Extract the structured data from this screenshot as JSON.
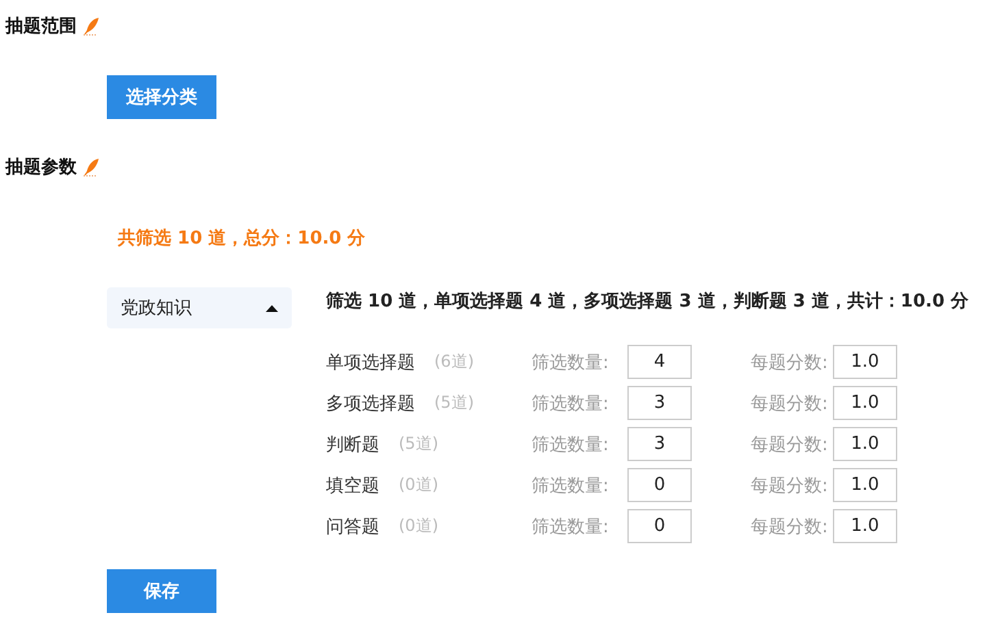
{
  "range_section": {
    "title": "抽题范围",
    "button": "选择分类"
  },
  "params_section": {
    "title": "抽题参数",
    "total": "共筛选 10 道，总分：10.0 分"
  },
  "category": {
    "name": "党政知识",
    "expanded": true,
    "summary": "筛选 10 道，单项选择题 4 道，多项选择题 3 道，判断题 3 道，共计：10.0 分"
  },
  "question_types": [
    {
      "name": "单项选择题",
      "available": "(6道)",
      "count_label": "筛选数量:",
      "count": "4",
      "score_label": "每题分数:",
      "score": "1.0"
    },
    {
      "name": "多项选择题",
      "available": "(5道)",
      "count_label": "筛选数量:",
      "count": "3",
      "score_label": "每题分数:",
      "score": "1.0"
    },
    {
      "name": "判断题",
      "available": "(5道)",
      "count_label": "筛选数量:",
      "count": "3",
      "score_label": "每题分数:",
      "score": "1.0"
    },
    {
      "name": "填空题",
      "available": "(0道)",
      "count_label": "筛选数量:",
      "count": "0",
      "score_label": "每题分数:",
      "score": "1.0"
    },
    {
      "name": "问答题",
      "available": "(0道)",
      "count_label": "筛选数量:",
      "count": "0",
      "score_label": "每题分数:",
      "score": "1.0"
    }
  ],
  "save_button": "保存"
}
